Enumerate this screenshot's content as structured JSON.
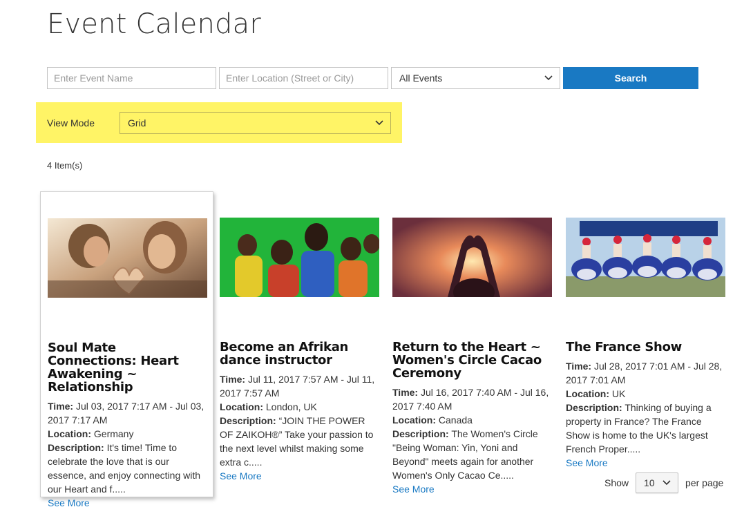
{
  "page": {
    "title": "Event Calendar"
  },
  "search": {
    "event_name_placeholder": "Enter Event Name",
    "location_placeholder": "Enter Location (Street or City)",
    "category_selected": "All Events",
    "button_label": "Search"
  },
  "view_mode": {
    "label": "View Mode",
    "selected": "Grid"
  },
  "results": {
    "count_text": "4 Item(s)"
  },
  "labels": {
    "time": "Time:",
    "location": "Location:",
    "description": "Description:",
    "see_more": "See More"
  },
  "events": [
    {
      "title": "Soul Mate Connections: Heart Awakening ~ Relationship",
      "time": "Jul 03, 2017 7:17 AM - Jul 03, 2017 7:17 AM",
      "location": "Germany",
      "description": "It's time! Time to celebrate the love that is our essence, and enjoy connecting with our Heart and f....."
    },
    {
      "title": "Become an Afrikan dance instructor",
      "time": "Jul 11, 2017 7:57 AM - Jul 11, 2017 7:57 AM",
      "location": "London, UK",
      "description": "“JOIN THE POWER OF ZAIKOH®” Take your passion to the next level whilst making some extra c....."
    },
    {
      "title": "Return to the Heart ~ Women's Circle Cacao Ceremony",
      "time": "Jul 16, 2017 7:40 AM - Jul 16, 2017 7:40 AM",
      "location": "Canada",
      "description": "The Women's Circle \"Being Woman: Yin, Yoni and Beyond\" meets again for another Women's Only Cacao Ce....."
    },
    {
      "title": "The France Show",
      "time": "Jul 28, 2017 7:01 AM - Jul 28, 2017 7:01 AM",
      "location": "UK",
      "description": "Thinking of buying a property in France? The France Show is home to the UK's largest French Proper....."
    }
  ],
  "pager": {
    "show_label": "Show",
    "per_page_value": "10",
    "per_page_label": "per page"
  },
  "colors": {
    "accent": "#1979c3",
    "highlight": "#fff466"
  }
}
